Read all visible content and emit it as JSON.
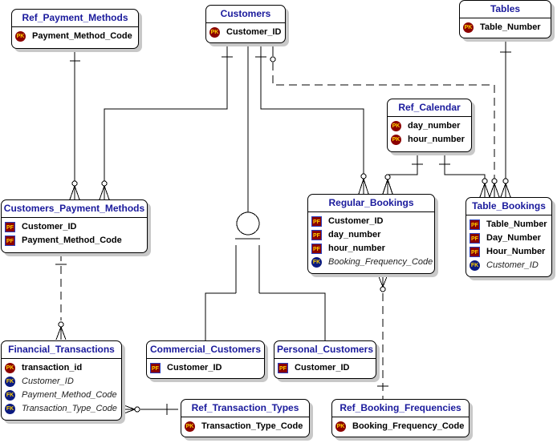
{
  "entities": {
    "ref_payment_methods": {
      "title": "Ref_Payment_Methods",
      "attrs": [
        {
          "key": "PK",
          "name": "Payment_Method_Code"
        }
      ]
    },
    "customers": {
      "title": "Customers",
      "attrs": [
        {
          "key": "PK",
          "name": "Customer_ID"
        }
      ]
    },
    "tables": {
      "title": "Tables",
      "attrs": [
        {
          "key": "PK",
          "name": "Table_Number"
        }
      ]
    },
    "ref_calendar": {
      "title": "Ref_Calendar",
      "attrs": [
        {
          "key": "PK",
          "name": "day_number"
        },
        {
          "key": "PK",
          "name": "hour_number"
        }
      ]
    },
    "customers_payment_methods": {
      "title": "Customers_Payment_Methods",
      "attrs": [
        {
          "key": "PF",
          "name": "Customer_ID"
        },
        {
          "key": "PF",
          "name": "Payment_Method_Code"
        }
      ]
    },
    "regular_bookings": {
      "title": "Regular_Bookings",
      "attrs": [
        {
          "key": "PF",
          "name": "Customer_ID"
        },
        {
          "key": "PF",
          "name": "day_number"
        },
        {
          "key": "PF",
          "name": "hour_number"
        },
        {
          "key": "FK",
          "name": "Booking_Frequency_Code"
        }
      ]
    },
    "table_bookings": {
      "title": "Table_Bookings",
      "attrs": [
        {
          "key": "PF",
          "name": "Table_Number"
        },
        {
          "key": "PF",
          "name": "Day_Number"
        },
        {
          "key": "PF",
          "name": "Hour_Number"
        },
        {
          "key": "FK",
          "name": "Customer_ID"
        }
      ]
    },
    "financial_transactions": {
      "title": "Financial_Transactions",
      "attrs": [
        {
          "key": "PK",
          "name": "transaction_id"
        },
        {
          "key": "FK",
          "name": "Customer_ID"
        },
        {
          "key": "FK",
          "name": "Payment_Method_Code"
        },
        {
          "key": "FK",
          "name": "Transaction_Type_Code"
        }
      ]
    },
    "commercial_customers": {
      "title": "Commercial_Customers",
      "attrs": [
        {
          "key": "PF",
          "name": "Customer_ID"
        }
      ]
    },
    "personal_customers": {
      "title": "Personal_Customers",
      "attrs": [
        {
          "key": "PF",
          "name": "Customer_ID"
        }
      ]
    },
    "ref_transaction_types": {
      "title": "Ref_Transaction_Types",
      "attrs": [
        {
          "key": "PK",
          "name": "Transaction_Type_Code"
        }
      ]
    },
    "ref_booking_frequencies": {
      "title": "Ref_Booking_Frequencies",
      "attrs": [
        {
          "key": "PK",
          "name": "Booking_Frequency_Code"
        }
      ]
    }
  },
  "relationships": [
    {
      "from": "Ref_Payment_Methods",
      "to": "Customers_Payment_Methods",
      "identifying": true
    },
    {
      "from": "Customers",
      "to": "Customers_Payment_Methods",
      "identifying": true
    },
    {
      "from": "Customers",
      "to": "Regular_Bookings",
      "identifying": true
    },
    {
      "from": "Customers",
      "to": "Table_Bookings",
      "identifying": false
    },
    {
      "from": "Customers",
      "to": "Commercial_Customers",
      "subtype": true
    },
    {
      "from": "Customers",
      "to": "Personal_Customers",
      "subtype": true
    },
    {
      "from": "Tables",
      "to": "Table_Bookings",
      "identifying": true
    },
    {
      "from": "Ref_Calendar",
      "to": "Regular_Bookings",
      "identifying": true
    },
    {
      "from": "Ref_Calendar",
      "to": "Table_Bookings",
      "identifying": true
    },
    {
      "from": "Customers_Payment_Methods",
      "to": "Financial_Transactions",
      "identifying": false
    },
    {
      "from": "Ref_Transaction_Types",
      "to": "Financial_Transactions",
      "identifying": false
    },
    {
      "from": "Ref_Booking_Frequencies",
      "to": "Regular_Bookings",
      "identifying": false
    }
  ],
  "colors": {
    "title": "#1a1a9c",
    "pk_badge": "#8b0000",
    "fk_badge": "#0a1a80",
    "badge_text": "#ffd000"
  }
}
